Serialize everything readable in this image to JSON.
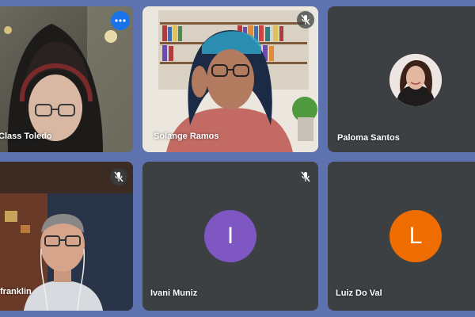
{
  "participants": [
    {
      "name": "Class Toledo",
      "state": "video",
      "active_speaker": true,
      "muted": false
    },
    {
      "name": "Solange Ramos",
      "state": "video",
      "active_speaker": false,
      "muted": true
    },
    {
      "name": "Paloma Santos",
      "state": "photo",
      "active_speaker": false,
      "muted": false
    },
    {
      "name": "franklin",
      "state": "video",
      "active_speaker": false,
      "muted": true
    },
    {
      "name": "Ivani Muniz",
      "state": "initial",
      "initial": "I",
      "avatar_color": "#7e57c2",
      "active_speaker": false,
      "muted": true
    },
    {
      "name": "Luiz Do Val",
      "state": "initial",
      "initial": "L",
      "avatar_color": "#ef6c00",
      "active_speaker": false,
      "muted": false
    }
  ],
  "icons": {
    "more": "more-options-icon",
    "mute": "mic-off-icon"
  },
  "colors": {
    "background": "#5d72ae",
    "tile": "#3c4043",
    "active_border": "#7aa7f0",
    "more_button": "#1a73e8"
  }
}
